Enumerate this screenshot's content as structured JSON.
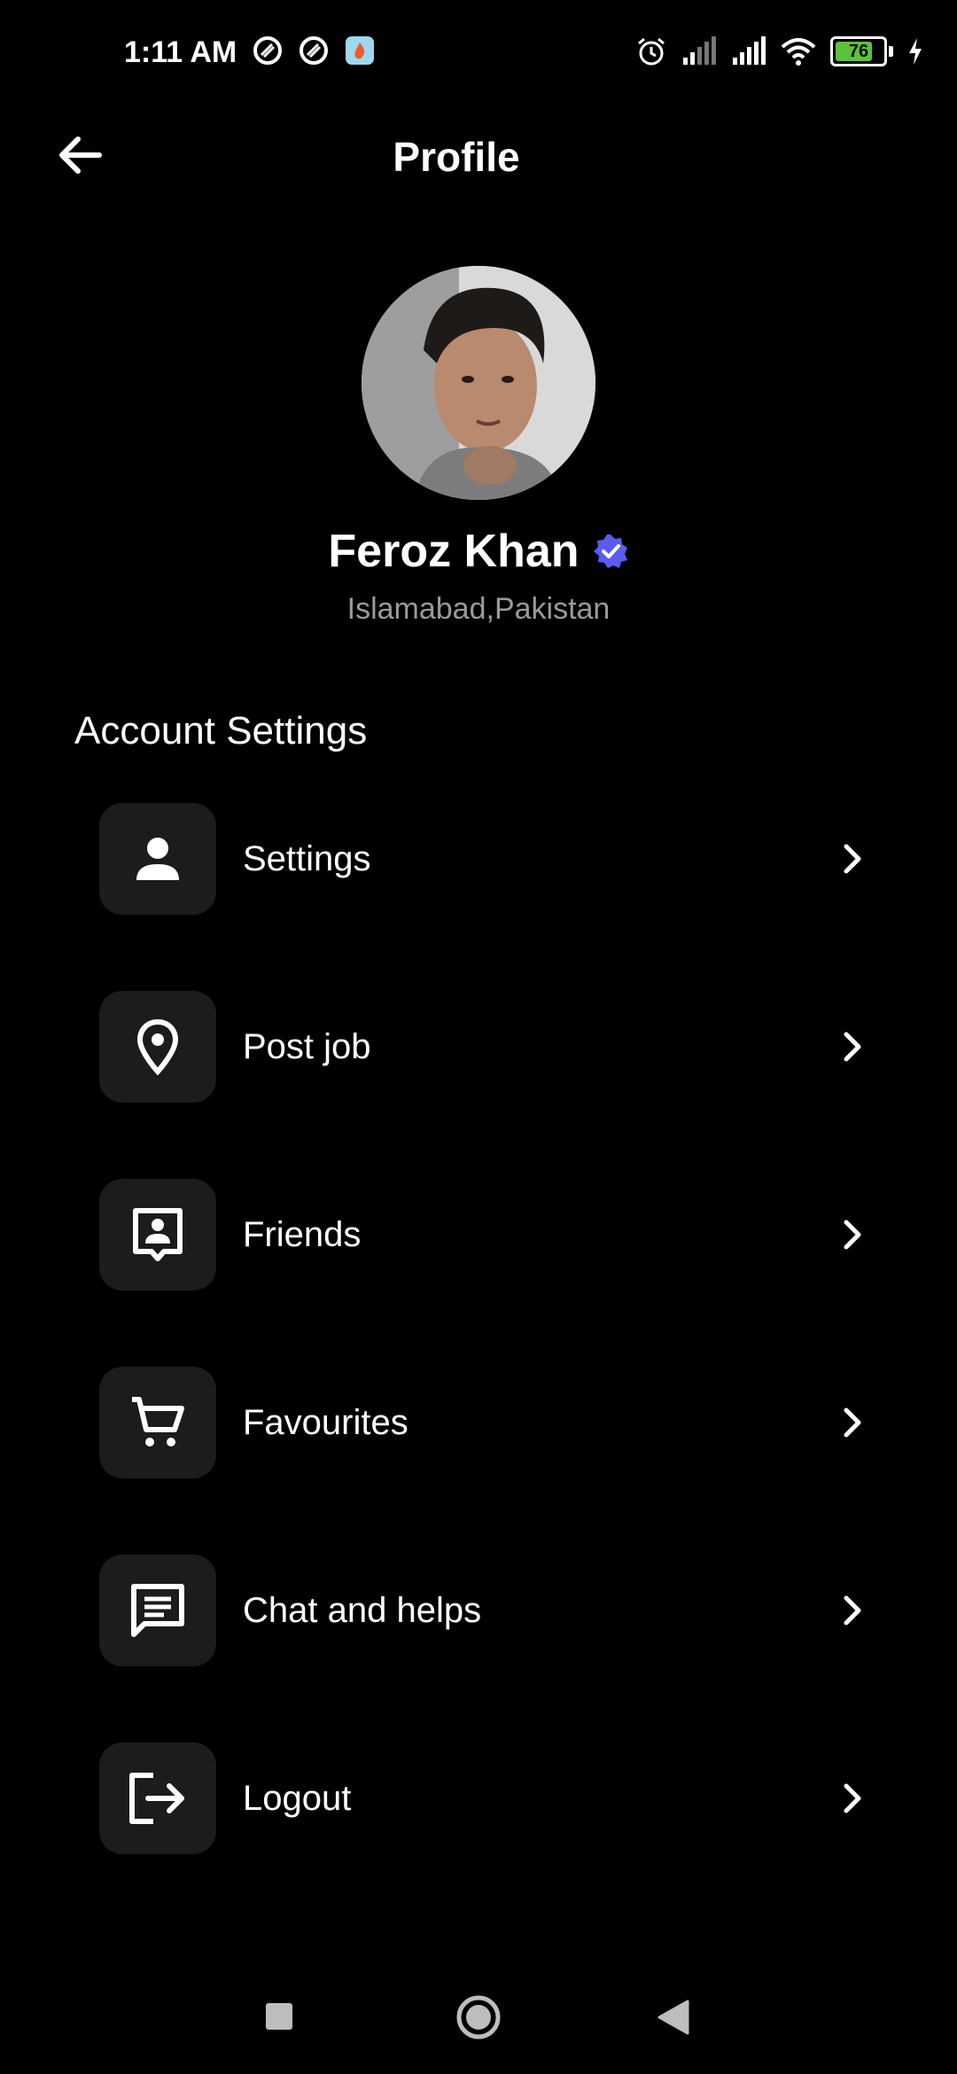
{
  "status_bar": {
    "time": "1:11 AM",
    "battery": "76",
    "icons": [
      "app-icon-1",
      "app-icon-2",
      "notification-app-icon",
      "alarm-icon",
      "signal-icon",
      "signal-icon",
      "wifi-icon",
      "battery-icon",
      "charging-icon"
    ]
  },
  "header": {
    "title": "Profile",
    "back_icon": "arrow-left-icon"
  },
  "profile": {
    "name": "Feroz Khan",
    "location": "Islamabad,Pakistan",
    "verified_icon": "verified-badge-icon",
    "verified_color": "#5b5bf0"
  },
  "section": {
    "title": "Account Settings"
  },
  "menu": [
    {
      "label": "Settings",
      "icon": "person-icon"
    },
    {
      "label": "Post job",
      "icon": "location-pin-icon"
    },
    {
      "label": "Friends",
      "icon": "contact-card-icon"
    },
    {
      "label": "Favourites",
      "icon": "cart-icon"
    },
    {
      "label": "Chat and helps",
      "icon": "chat-icon"
    },
    {
      "label": "Logout",
      "icon": "logout-icon"
    }
  ],
  "nav": {
    "icons": [
      "recents-square-icon",
      "home-circle-icon",
      "back-triangle-icon"
    ]
  }
}
